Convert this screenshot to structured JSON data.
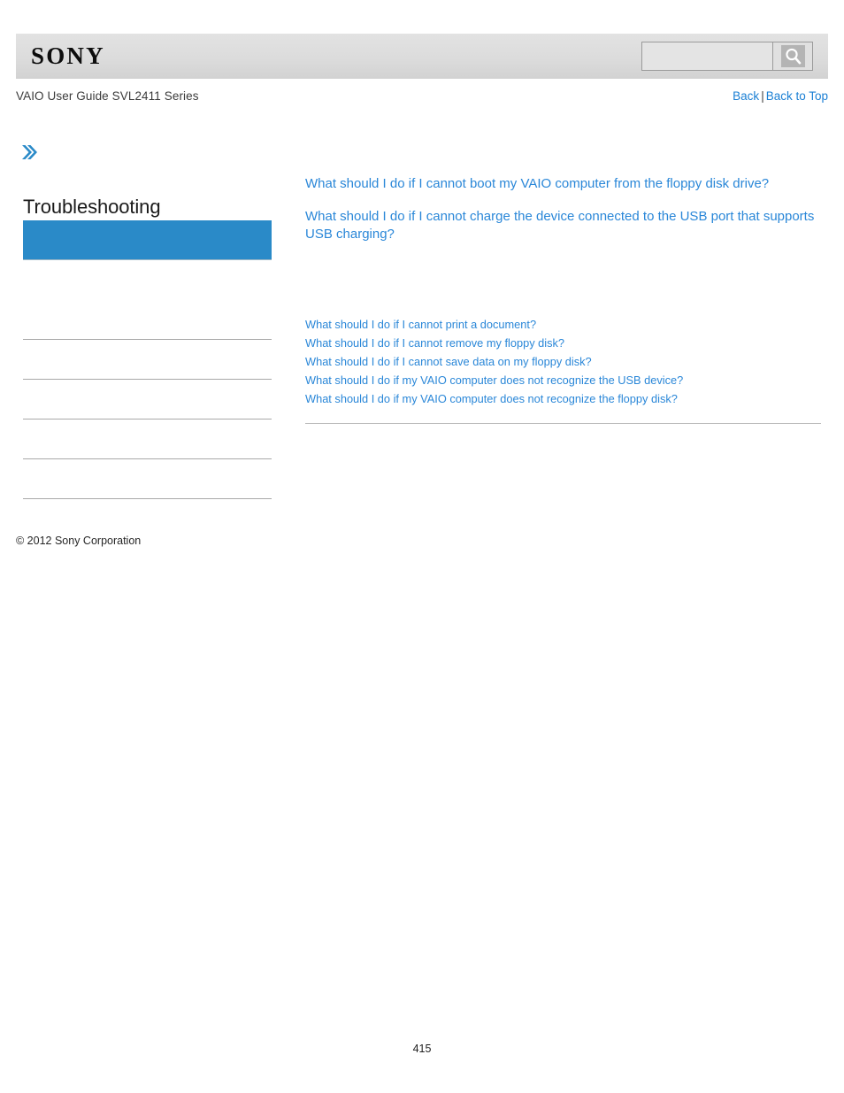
{
  "header": {
    "logo_text": "SONY",
    "search": {
      "value": "",
      "placeholder": "",
      "button_icon": "search-icon"
    }
  },
  "subheader": {
    "guide_title": "VAIO User Guide SVL2411 Series",
    "nav": {
      "back_label": "Back",
      "separator": "|",
      "back_to_top_label": "Back to Top"
    }
  },
  "sidebar": {
    "arrow_icon": "double-chevron-right-icon",
    "section_title": "Troubleshooting",
    "items": [
      {
        "label": "",
        "active": true
      },
      {
        "label": "",
        "active": false
      },
      {
        "label": "",
        "active": false
      },
      {
        "label": "",
        "active": false
      },
      {
        "label": "",
        "active": false
      },
      {
        "label": "",
        "active": false
      },
      {
        "label": "",
        "active": false
      }
    ],
    "copyright": "© 2012 Sony Corporation"
  },
  "main": {
    "featured_links": [
      "What should I do if I cannot boot my VAIO computer from the floppy disk drive?",
      "What should I do if I cannot charge the device connected to the USB port that supports USB charging?"
    ],
    "related_links": [
      "What should I do if I cannot print a document?",
      "What should I do if I cannot remove my floppy disk?",
      "What should I do if I cannot save data on my floppy disk?",
      "What should I do if my VAIO computer does not recognize the USB device?",
      "What should I do if my VAIO computer does not recognize the floppy disk?"
    ]
  },
  "footer": {
    "page_number": "415"
  },
  "colors": {
    "link_blue": "#2a87d8",
    "nav_blue": "#1a7fd4",
    "active_item_blue": "#2a8ac8",
    "header_gray": "#dcdcdc",
    "rule_gray": "#a8a8a8"
  }
}
